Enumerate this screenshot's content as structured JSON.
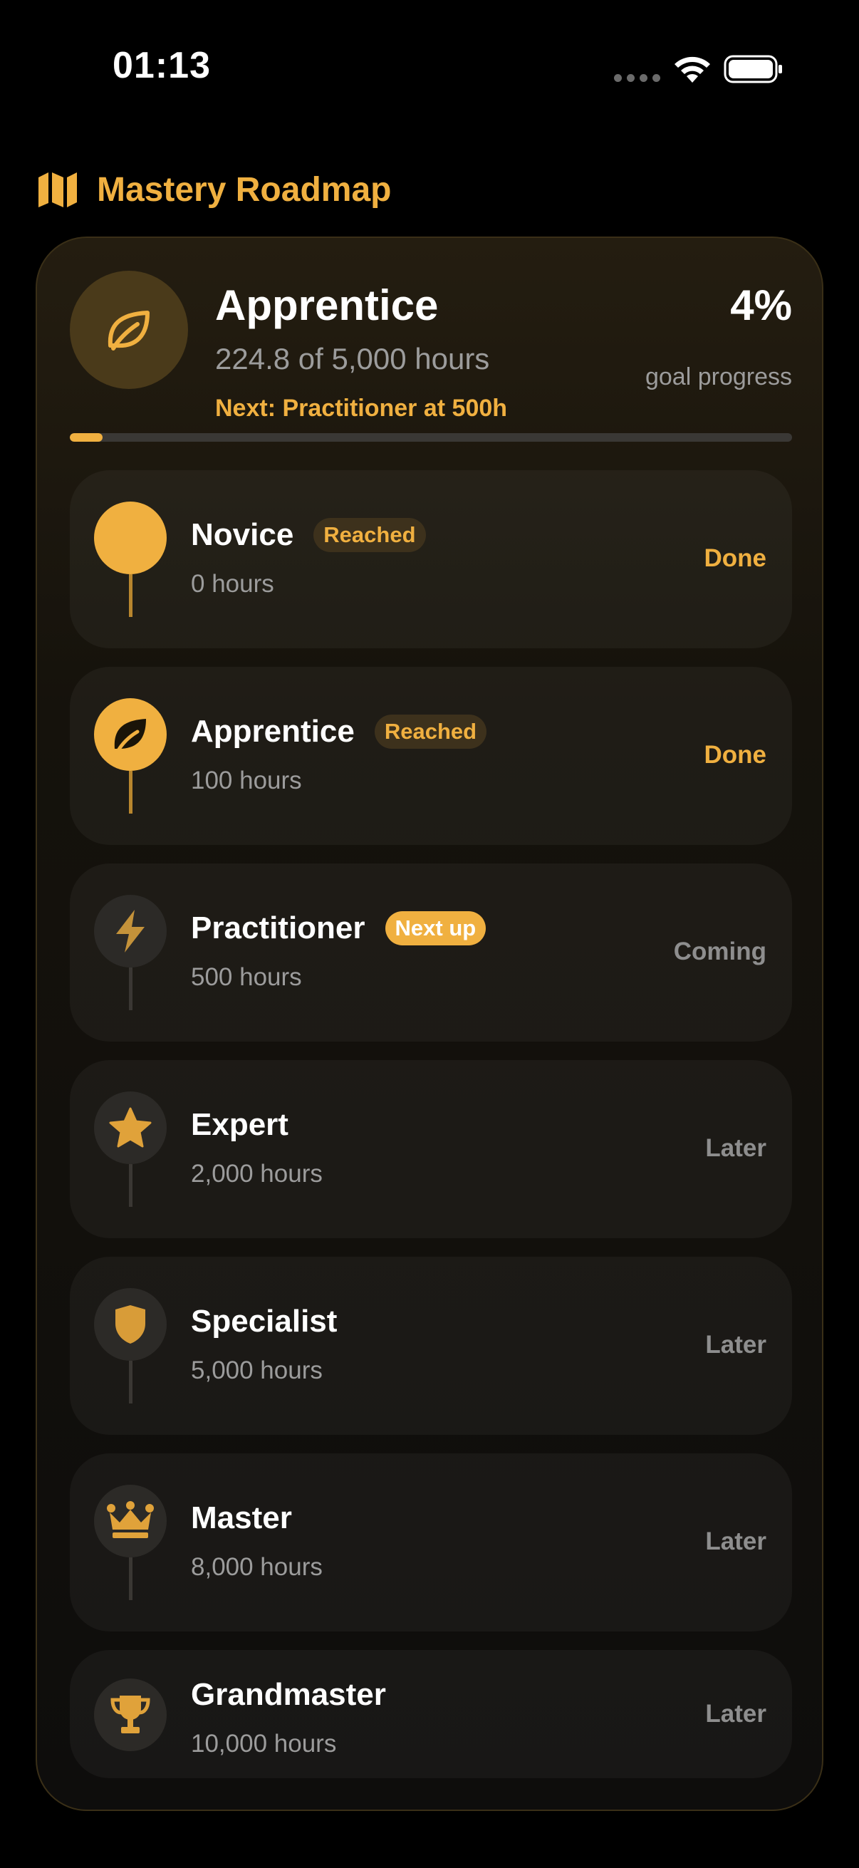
{
  "status_bar": {
    "time": "01:13"
  },
  "header": {
    "title": "Mastery Roadmap",
    "icon": "map-icon"
  },
  "summary": {
    "level": "Apprentice",
    "hours": "224.8 of 5,000 hours",
    "next": "Next: Practitioner at 500h",
    "percent": "4%",
    "percent_label": "goal progress",
    "progress_fraction": 0.045,
    "icon": "leaf-icon"
  },
  "milestones": [
    {
      "name": "Novice",
      "hours": "0 hours",
      "badge": "Reached",
      "status": "Done",
      "icon": "circle-icon"
    },
    {
      "name": "Apprentice",
      "hours": "100 hours",
      "badge": "Reached",
      "status": "Done",
      "icon": "leaf-icon"
    },
    {
      "name": "Practitioner",
      "hours": "500 hours",
      "badge": "Next up",
      "status": "Coming",
      "icon": "bolt-icon"
    },
    {
      "name": "Expert",
      "hours": "2,000 hours",
      "status": "Later",
      "icon": "star-icon"
    },
    {
      "name": "Specialist",
      "hours": "5,000 hours",
      "status": "Later",
      "icon": "shield-icon"
    },
    {
      "name": "Master",
      "hours": "8,000 hours",
      "status": "Later",
      "icon": "crown-icon"
    },
    {
      "name": "Grandmaster",
      "hours": "10,000 hours",
      "status": "Later",
      "icon": "trophy-icon"
    }
  ],
  "colors": {
    "accent": "#f0b040",
    "background": "#000000",
    "muted_text": "#9c9c9c"
  }
}
